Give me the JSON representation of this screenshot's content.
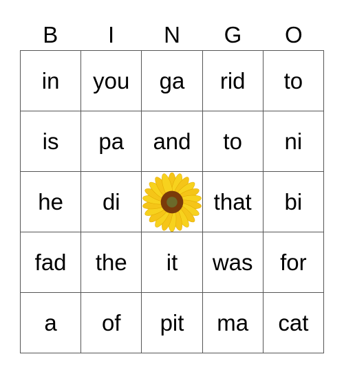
{
  "header": [
    "B",
    "I",
    "N",
    "G",
    "O"
  ],
  "cells": [
    [
      "in",
      "you",
      "ga",
      "rid",
      "to"
    ],
    [
      "is",
      "pa",
      "and",
      "to",
      "ni"
    ],
    [
      "he",
      "di",
      "",
      "that",
      "bi"
    ],
    [
      "fad",
      "the",
      "it",
      "was",
      "for"
    ],
    [
      "a",
      "of",
      "pit",
      "ma",
      "cat"
    ]
  ],
  "free_space": {
    "icon": "sunflower-icon",
    "row": 2,
    "col": 2
  },
  "colors": {
    "petal": "#f5c518",
    "center": "#7a3a0a",
    "border": "#555555"
  }
}
